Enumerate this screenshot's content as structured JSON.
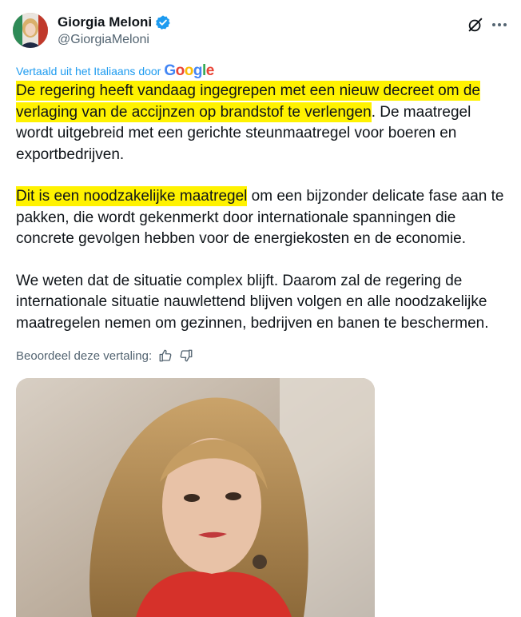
{
  "author": {
    "name": "Giorgia Meloni",
    "handle": "@GiorgiaMeloni"
  },
  "translation": {
    "label": "Vertaald uit het Italiaans door",
    "provider": "Google",
    "rate_label": "Beoordeel deze vertaling:"
  },
  "tweet": {
    "p1_highlight": "De regering heeft vandaag ingegrepen met een nieuw decreet om de verlaging van de accijnzen op brandstof te verlengen",
    "p1_rest": ". De maatregel wordt uitgebreid met een gerichte steunmaatregel voor boeren en exportbedrijven.",
    "p2_highlight": "Dit is een noodzakelijke maatregel",
    "p2_rest": " om een bijzonder delicate fase aan te pakken, die wordt gekenmerkt door internationale spanningen die concrete gevolgen hebben voor de energiekosten en de economie.",
    "p3": "We weten dat de situatie complex blijft. Daarom zal de regering de internationale situatie nauwlettend blijven volgen en alle noodzakelijke maatregelen nemen om gezinnen, bedrijven en banen te beschermen."
  },
  "icons": {
    "verified": "verified-badge-icon",
    "grok": "grok-icon",
    "more": "more-icon",
    "thumbs_up": "thumbs-up-icon",
    "thumbs_down": "thumbs-down-icon"
  },
  "colors": {
    "highlight": "#fff200",
    "link": "#1d9bf0",
    "secondary_text": "#536471"
  }
}
